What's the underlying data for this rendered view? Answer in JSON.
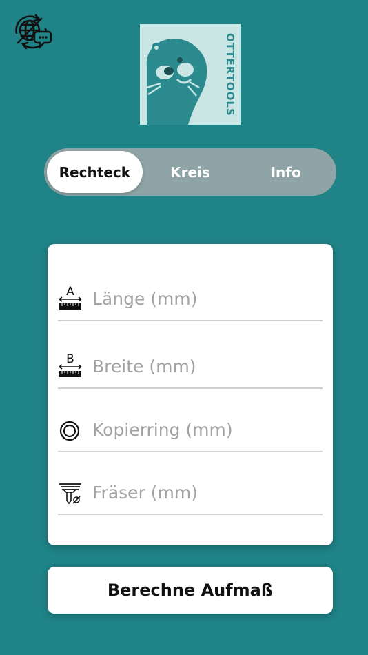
{
  "header": {
    "language_icon": "globe-chat-icon",
    "logo_text": "OTTERTOOLS"
  },
  "tabs": [
    {
      "label": "Rechteck",
      "active": true
    },
    {
      "label": "Kreis",
      "active": false
    },
    {
      "label": "Info",
      "active": false
    }
  ],
  "form": {
    "fields": [
      {
        "icon": "length-a-icon",
        "placeholder": "Länge (mm)",
        "value": ""
      },
      {
        "icon": "width-b-icon",
        "placeholder": "Breite (mm)",
        "value": ""
      },
      {
        "icon": "copy-ring-icon",
        "placeholder": "Kopierring (mm)",
        "value": ""
      },
      {
        "icon": "router-bit-icon",
        "placeholder": "Fräser (mm)",
        "value": ""
      }
    ]
  },
  "actions": {
    "calculate_label": "Berechne Aufmaß"
  },
  "colors": {
    "background": "#1f8387",
    "logo_bg": "#c9e6e5",
    "segment_bg": "#8fa4a6"
  }
}
